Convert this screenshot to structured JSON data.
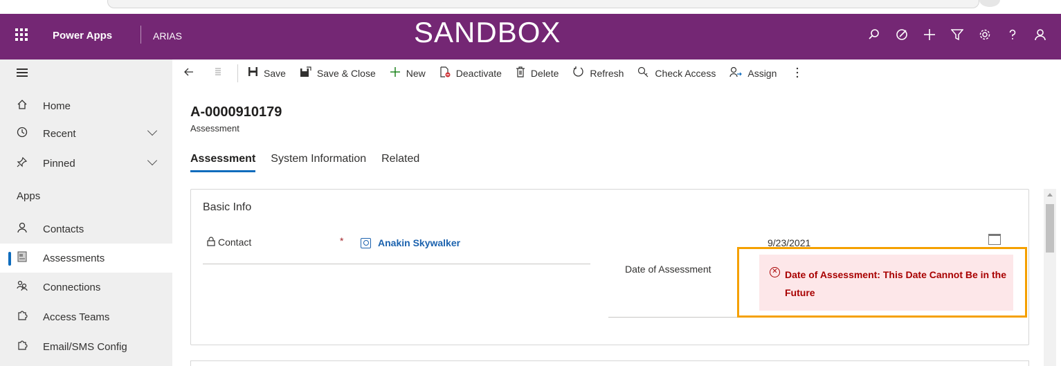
{
  "topbar": {
    "brand": "Power Apps",
    "app_name": "ARIAS",
    "environment_banner": "SANDBOX",
    "icons": [
      "search-icon",
      "target-icon",
      "plus-icon",
      "filter-icon",
      "settings-icon",
      "help-icon",
      "user-icon"
    ]
  },
  "sidebar": {
    "items": [
      {
        "label": "Home",
        "icon": "home-icon"
      },
      {
        "label": "Recent",
        "icon": "clock-icon"
      },
      {
        "label": "Pinned",
        "icon": "pin-icon"
      }
    ],
    "apps_heading": "Apps",
    "apps": [
      {
        "label": "Contacts",
        "icon": "person-icon"
      },
      {
        "label": "Assessments",
        "icon": "assessment-icon"
      },
      {
        "label": "Connections",
        "icon": "connections-icon"
      },
      {
        "label": "Access Teams",
        "icon": "puzzle-icon"
      },
      {
        "label": "Email/SMS Config",
        "icon": "puzzle-icon"
      }
    ]
  },
  "commandbar": {
    "save": "Save",
    "save_close": "Save & Close",
    "new": "New",
    "deactivate": "Deactivate",
    "delete": "Delete",
    "refresh": "Refresh",
    "check_access": "Check Access",
    "assign": "Assign"
  },
  "record": {
    "title": "A-0000910179",
    "entity": "Assessment"
  },
  "tabs": [
    "Assessment",
    "System Information",
    "Related"
  ],
  "form": {
    "section_title": "Basic Info",
    "contact_label": "Contact",
    "required_mark": "*",
    "contact_value": "Anakin Skywalker",
    "date_label": "Date of Assessment",
    "date_value": "9/23/2021",
    "error_message": "Date of Assessment: This Date Cannot Be in the Future"
  },
  "colors": {
    "topbar": "#742774",
    "accent": "#0f6cbd",
    "error_text": "#a80000",
    "error_bg": "#fde7e9",
    "highlight": "#f5a000"
  }
}
